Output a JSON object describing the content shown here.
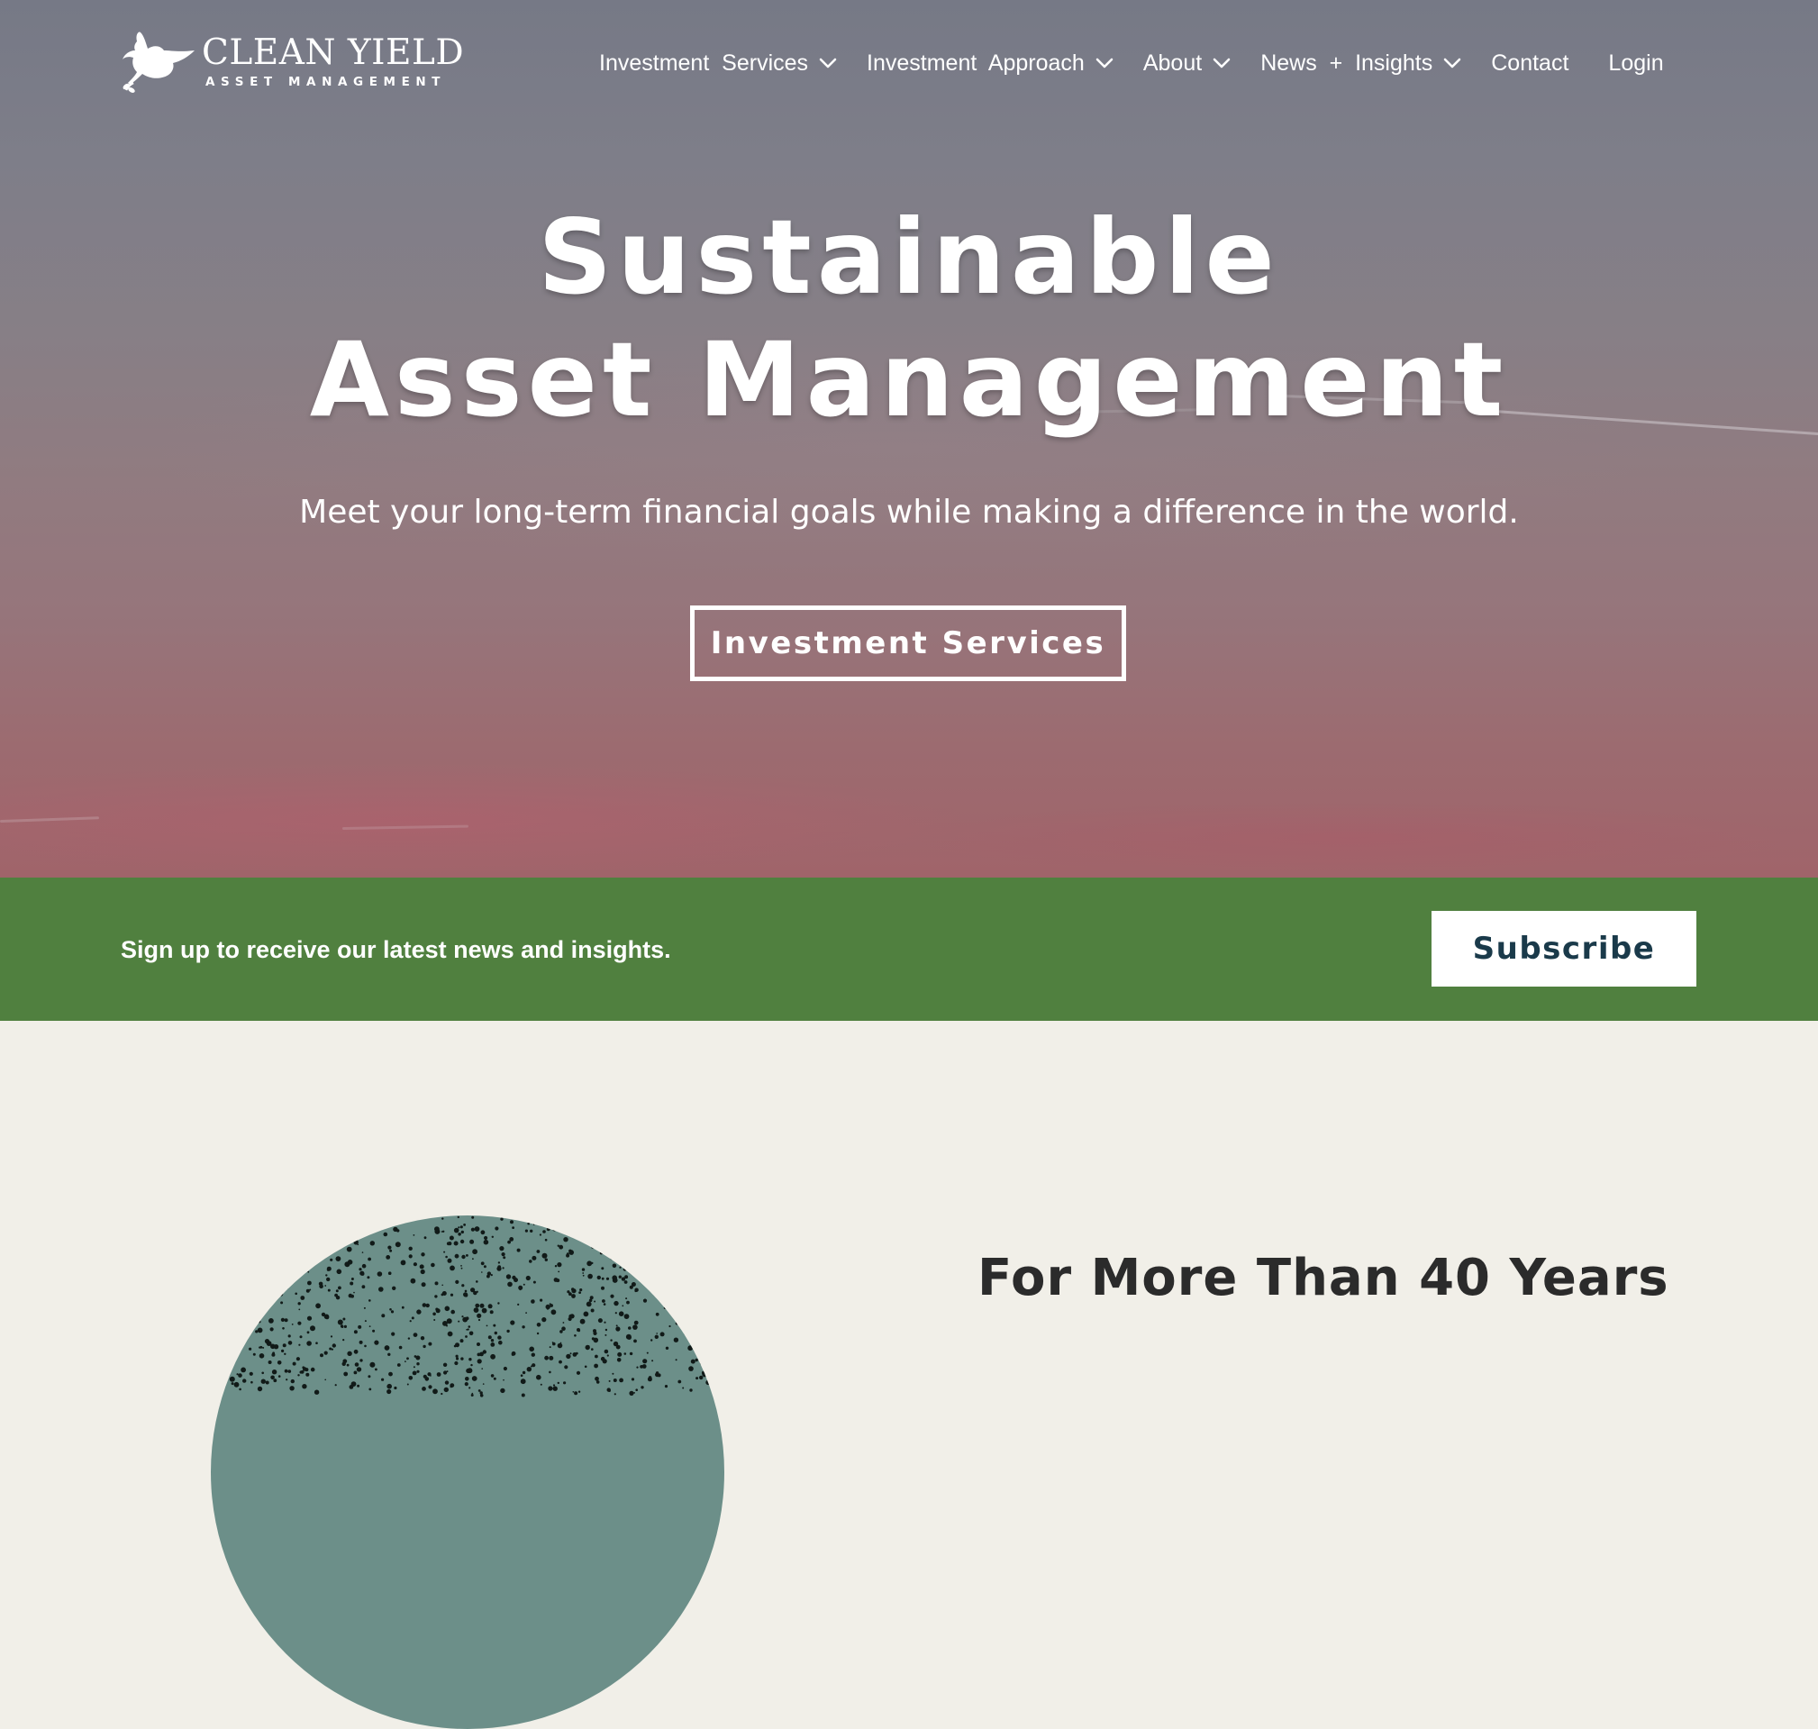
{
  "logo": {
    "title": "CLEAN YIELD",
    "subtitle": "ASSET MANAGEMENT",
    "icon": "dove-icon"
  },
  "nav": {
    "items": [
      {
        "label": "Investment  Services",
        "has_dropdown": true
      },
      {
        "label": "Investment  Approach",
        "has_dropdown": true
      },
      {
        "label": "About",
        "has_dropdown": true
      },
      {
        "label": "News  +  Insights",
        "has_dropdown": true
      },
      {
        "label": "Contact",
        "has_dropdown": false
      },
      {
        "label": "Login",
        "has_dropdown": false
      }
    ],
    "dropdown_icon": "chevron-down-icon"
  },
  "hero": {
    "title_line1": "Sustainable",
    "title_line2": "Asset Management",
    "subtitle": "Meet your long-term financial goals while making a difference in the world.",
    "cta_label": "Investment Services"
  },
  "subscribe": {
    "text": "Sign up to receive our latest news and insights.",
    "button_label": "Subscribe"
  },
  "about": {
    "heading": "For More Than 40 Years"
  },
  "colors": {
    "subscribe_bar": "#50803f",
    "page_background": "#f1efe8",
    "subscribe_button_text": "#1a3a4a",
    "heading_text": "#2b2b2b",
    "circle": "#6c8f89"
  }
}
